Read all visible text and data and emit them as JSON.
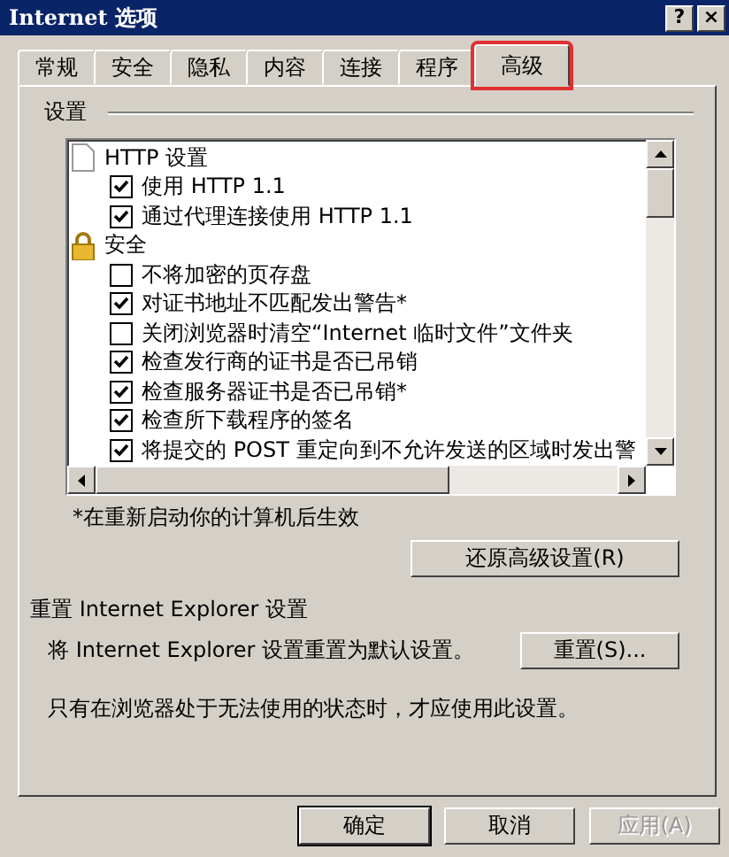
{
  "window": {
    "title": "Internet 选项",
    "help_button": "?",
    "close_button": "×"
  },
  "tabs": [
    {
      "label": "常规",
      "selected": false
    },
    {
      "label": "安全",
      "selected": false
    },
    {
      "label": "隐私",
      "selected": false
    },
    {
      "label": "内容",
      "selected": false
    },
    {
      "label": "连接",
      "selected": false
    },
    {
      "label": "程序",
      "selected": false
    },
    {
      "label": "高级",
      "selected": true
    }
  ],
  "settings_group": {
    "title": "设置",
    "items": [
      {
        "kind": "pagegroup",
        "label": "HTTP 设置"
      },
      {
        "kind": "checkbox",
        "label": "使用 HTTP 1.1",
        "checked": true
      },
      {
        "kind": "checkbox",
        "label": "通过代理连接使用 HTTP 1.1",
        "checked": true
      },
      {
        "kind": "lockgroup",
        "label": "安全"
      },
      {
        "kind": "checkbox",
        "label": "不将加密的页存盘",
        "checked": false
      },
      {
        "kind": "checkbox",
        "label": "对证书地址不匹配发出警告*",
        "checked": true
      },
      {
        "kind": "checkbox",
        "label": "关闭浏览器时清空“Internet 临时文件”文件夹",
        "checked": false
      },
      {
        "kind": "checkbox",
        "label": "检查发行商的证书是否已吊销",
        "checked": true
      },
      {
        "kind": "checkbox",
        "label": "检查服务器证书是否已吊销*",
        "checked": true
      },
      {
        "kind": "checkbox",
        "label": "检查所下载程序的签名",
        "checked": true
      },
      {
        "kind": "checkbox",
        "label": "将提交的 POST 重定向到不允许发送的区域时发出警",
        "checked": true
      }
    ],
    "note": "*在重新启动你的计算机后生效",
    "restore_button": "还原高级设置(R)"
  },
  "reset_section": {
    "title": "重置 Internet Explorer 设置",
    "description": "将 Internet Explorer 设置重置为默认设置。",
    "reset_button": "重置(S)...",
    "warning": "只有在浏览器处于无法使用的状态时，才应使用此设置。"
  },
  "buttons": [
    {
      "label": "确定",
      "disabled": false,
      "default": true
    },
    {
      "label": "取消",
      "disabled": false,
      "default": false
    },
    {
      "label": "应用(A)",
      "disabled": true,
      "default": false
    }
  ]
}
